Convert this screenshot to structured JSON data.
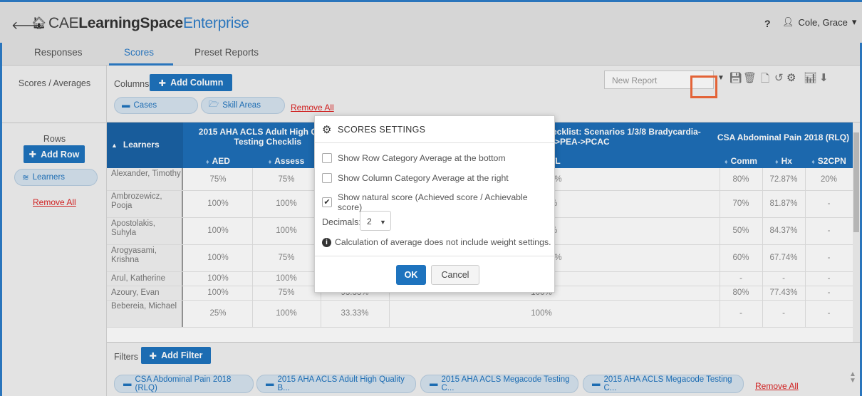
{
  "header": {
    "brand_part1": "CAE",
    "brand_part2": "LearningSpace",
    "brand_part3": "Enterprise",
    "help": "?",
    "user": "Cole, Grace",
    "user_caret": "▾"
  },
  "tabs": [
    {
      "label": "Responses",
      "active": false
    },
    {
      "label": "Scores",
      "active": true
    },
    {
      "label": "Preset Reports",
      "active": false
    }
  ],
  "left": {
    "title": "Scores / Averages",
    "rows_title": "Rows",
    "add_row": "Add Row",
    "learners_pill": "Learners",
    "remove_all": "Remove All"
  },
  "toolbar": {
    "columns_label": "Columns",
    "add_column": "Add Column",
    "cases_pill": "Cases",
    "skill_pill": "Skill Areas",
    "remove_all": "Remove All",
    "report_placeholder": "New Report"
  },
  "table": {
    "learners_header": "Learners",
    "group1": "2015 AHA ACLS Adult High Qu",
    "group1_line2": "Testing Checklis",
    "group2": "ecklist: Scenarios 1/3/8 Bradycardia-",
    "group2_line2": "->PEA->PCAC",
    "group3": "CSA Abdominal Pain 2018 (RLQ)",
    "sub_aed": "AED",
    "sub_assess": "Assess",
    "sub_tl": "TL",
    "sub_comm": "Comm",
    "sub_hx": "Hx",
    "sub_s2cpn": "S2CPN",
    "rows": [
      {
        "name": "Alexander, Timothy",
        "aed": "75%",
        "assess": "75%",
        "c3": "",
        "tl": "7%",
        "comm": "80%",
        "hx": "72.87%",
        "s2cpn": "20%"
      },
      {
        "name": "Ambrozewicz, Pooja",
        "aed": "100%",
        "assess": "100%",
        "c3": "",
        "tl": "%",
        "comm": "70%",
        "hx": "81.87%",
        "s2cpn": "-"
      },
      {
        "name": "Apostolakis, Suhyla",
        "aed": "100%",
        "assess": "100%",
        "c3": "",
        "tl": "%",
        "comm": "50%",
        "hx": "84.37%",
        "s2cpn": "-"
      },
      {
        "name": "Arogyasami, Krishna",
        "aed": "100%",
        "assess": "75%",
        "c3": "",
        "tl": "7%",
        "comm": "60%",
        "hx": "67.74%",
        "s2cpn": "-"
      },
      {
        "name": "Arul, Katherine",
        "aed": "100%",
        "assess": "100%",
        "c3": "",
        "tl": "",
        "comm": "-",
        "hx": "-",
        "s2cpn": "-"
      },
      {
        "name": "Azoury, Evan",
        "aed": "100%",
        "assess": "75%",
        "c3": "93.33%",
        "tl": "100%",
        "comm": "80%",
        "hx": "77.43%",
        "s2cpn": "-"
      },
      {
        "name": "Bebereia, Michael",
        "aed": "25%",
        "assess": "100%",
        "c3": "33.33%",
        "tl": "100%",
        "comm": "-",
        "hx": "-",
        "s2cpn": "-"
      }
    ]
  },
  "filters": {
    "label": "Filters",
    "add_filter": "Add Filter",
    "pills": [
      "CSA Abdominal Pain 2018 (RLQ)",
      "2015 AHA ACLS Adult High Quality B...",
      "2015 AHA ACLS Megacode Testing C...",
      "2015 AHA ACLS Megacode Testing C..."
    ],
    "remove_all": "Remove All"
  },
  "modal": {
    "title": "SCORES SETTINGS",
    "opt1": "Show Row Category Average at the bottom",
    "opt1_checked": false,
    "opt2": "Show Column Category Average at the right",
    "opt2_checked": false,
    "opt3": "Show natural score (Achieved score / Achievable score)",
    "opt3_checked": true,
    "decimals_label": "Decimals:",
    "decimals_value": "2",
    "info": "Calculation of average does not include weight settings.",
    "ok": "OK",
    "cancel": "Cancel"
  },
  "colors": {
    "accent": "#1e73be",
    "highlight": "#f26a3b",
    "remove_link": "#dd2222"
  }
}
